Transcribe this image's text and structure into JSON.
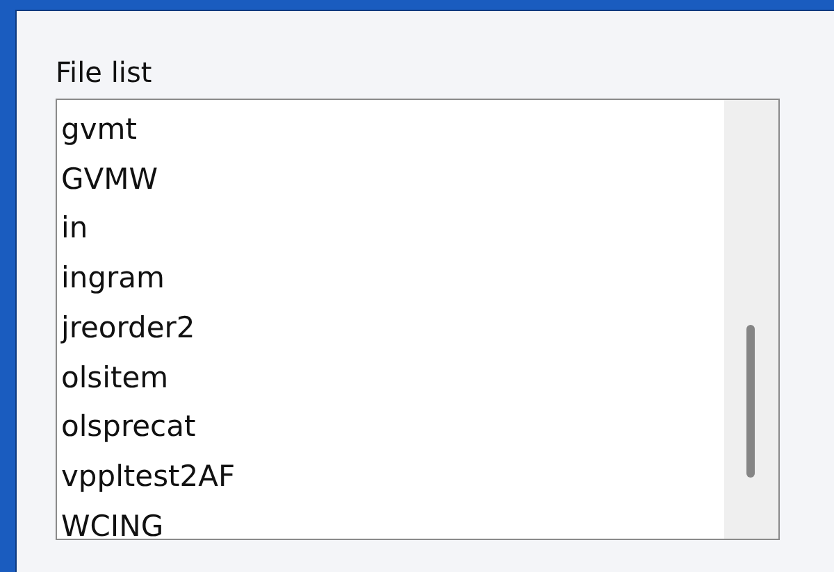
{
  "file_list": {
    "label": "File list",
    "items": [
      {
        "name": "gvmt",
        "selected": false
      },
      {
        "name": "GVMW",
        "selected": false
      },
      {
        "name": "in",
        "selected": false
      },
      {
        "name": "ingram",
        "selected": false
      },
      {
        "name": "jreorder2",
        "selected": false
      },
      {
        "name": "olsitem",
        "selected": false
      },
      {
        "name": "olsprecat",
        "selected": false
      },
      {
        "name": "vppltest2AF",
        "selected": false
      },
      {
        "name": "WCING",
        "selected": false
      }
    ]
  }
}
